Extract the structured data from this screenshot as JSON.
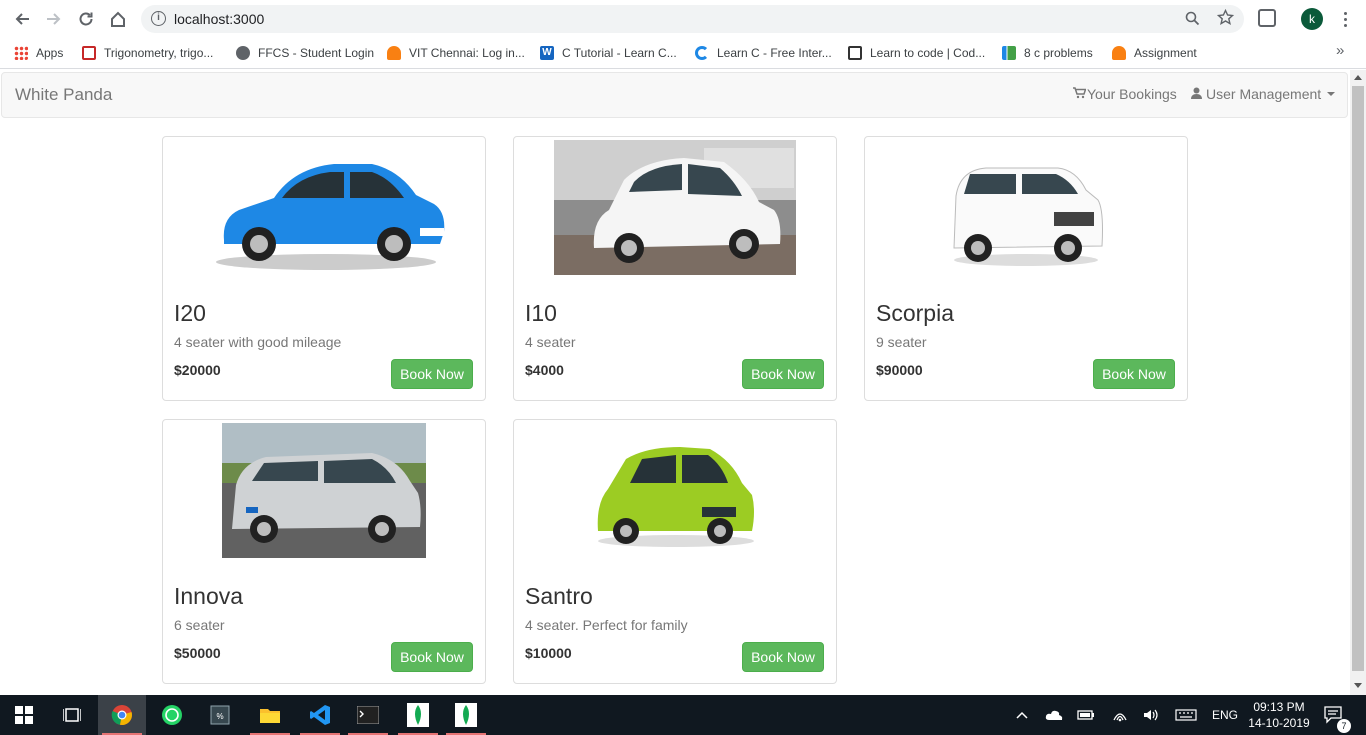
{
  "browser": {
    "url": "localhost:3000",
    "profile_initial": "k",
    "bookmarks": [
      {
        "label": "Apps",
        "icon": "apps-grid-icon"
      },
      {
        "label": "Trigonometry, trigo...",
        "icon": "math-site-icon"
      },
      {
        "label": "FFCS - Student Login",
        "icon": "globe-icon"
      },
      {
        "label": "VIT Chennai: Log in...",
        "icon": "moodle-icon"
      },
      {
        "label": "C Tutorial - Learn C...",
        "icon": "w-site-icon"
      },
      {
        "label": "Learn C - Free Inter...",
        "icon": "c-site-icon"
      },
      {
        "label": "Learn to code | Cod...",
        "icon": "code-site-icon"
      },
      {
        "label": "8 c problems",
        "icon": "chart-site-icon"
      },
      {
        "label": "Assignment",
        "icon": "moodle-icon"
      }
    ]
  },
  "navbar": {
    "brand": "White Panda",
    "bookings": "Your Bookings",
    "user_management": "User Management"
  },
  "cars": [
    {
      "name": "I20",
      "desc": "4 seater with good mileage",
      "price": "$20000",
      "button": "Book Now",
      "color": "#1e88e5"
    },
    {
      "name": "I10",
      "desc": "4 seater",
      "price": "$4000",
      "button": "Book Now",
      "color": "#f2f2f2"
    },
    {
      "name": "Scorpia",
      "desc": "9 seater",
      "price": "$90000",
      "button": "Book Now",
      "color": "#f5f5f5"
    },
    {
      "name": "Innova",
      "desc": "6 seater",
      "price": "$50000",
      "button": "Book Now",
      "color": "#c8c8c8"
    },
    {
      "name": "Santro",
      "desc": "4 seater. Perfect for family",
      "price": "$10000",
      "button": "Book Now",
      "color": "#9ccc23"
    }
  ],
  "taskbar": {
    "language": "ENG",
    "time": "09:13 PM",
    "date": "14-10-2019",
    "notification_count": "7"
  }
}
